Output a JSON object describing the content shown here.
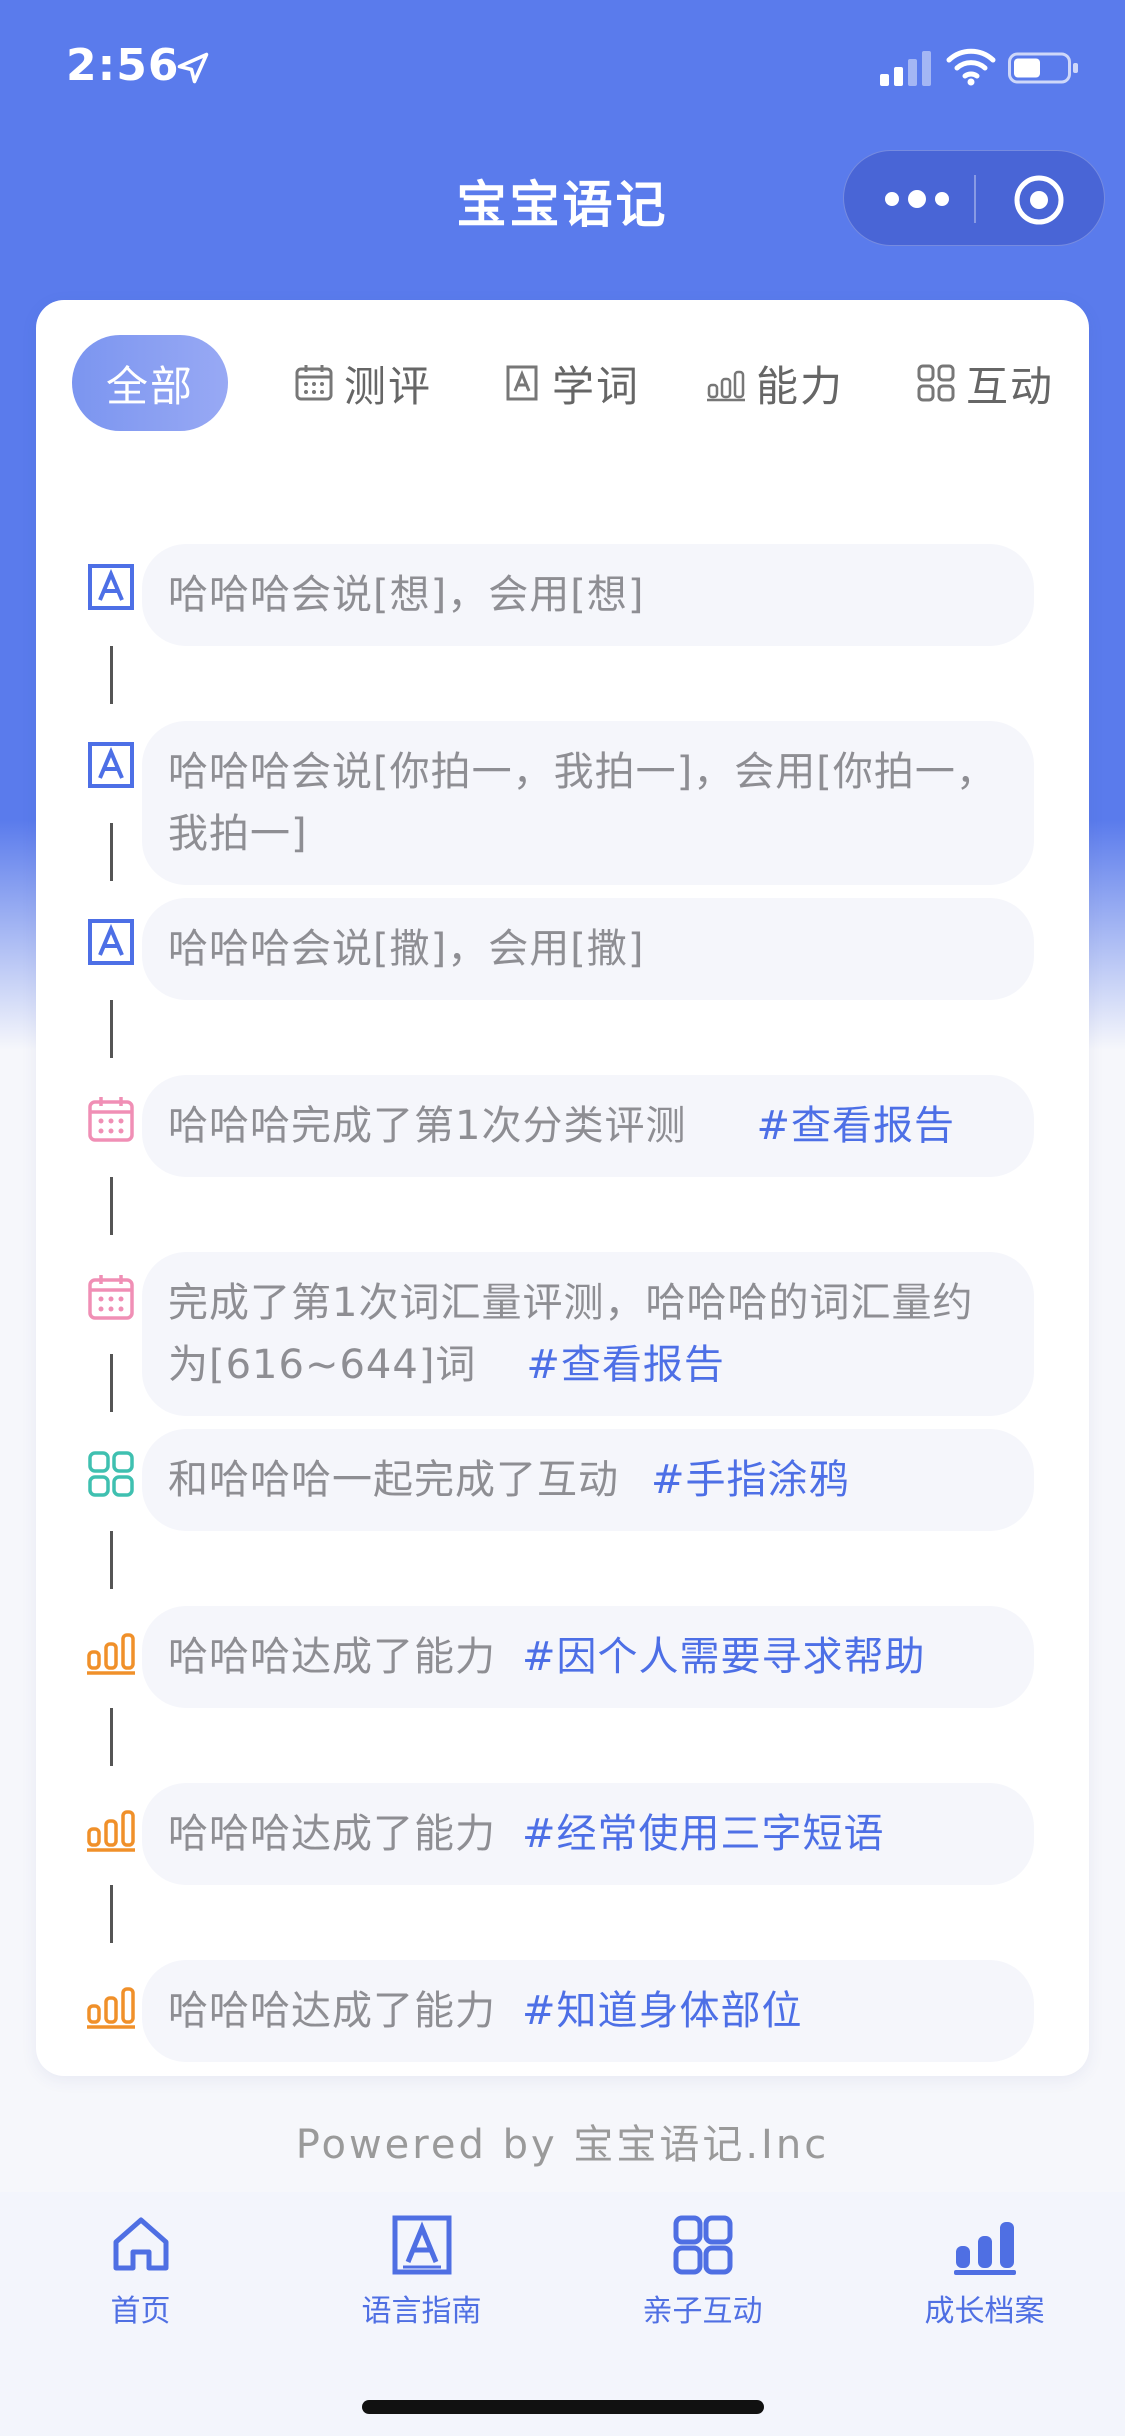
{
  "status_bar": {
    "time": "2:56"
  },
  "nav": {
    "title": "宝宝语记"
  },
  "tabs": [
    {
      "label": "全部",
      "icon": "none",
      "active": true
    },
    {
      "label": "测评",
      "icon": "calendar-icon"
    },
    {
      "label": "学词",
      "icon": "letter-a-icon"
    },
    {
      "label": "能力",
      "icon": "bar-chart-icon"
    },
    {
      "label": "互动",
      "icon": "grid-icon"
    }
  ],
  "timeline": [
    {
      "type": "learn",
      "icon": "letter-a-icon",
      "text": "哈哈哈会说[想]，会用[想]",
      "link": ""
    },
    {
      "type": "learn",
      "icon": "letter-a-icon",
      "text": "哈哈哈会说[你拍一，我拍一]，会用[你拍一，我拍一]",
      "link": ""
    },
    {
      "type": "learn",
      "icon": "letter-a-icon",
      "text": "哈哈哈会说[撒]，会用[撒]",
      "link": ""
    },
    {
      "type": "assess",
      "icon": "calendar-icon",
      "text": "哈哈哈完成了第1次分类评测",
      "link": "#查看报告"
    },
    {
      "type": "assess",
      "icon": "calendar-icon",
      "text": "完成了第1次词汇量评测，哈哈哈的词汇量约为[616~644]词",
      "link": "#查看报告"
    },
    {
      "type": "interact",
      "icon": "grid-icon",
      "text": "和哈哈哈一起完成了互动",
      "link": "#手指涂鸦"
    },
    {
      "type": "ability",
      "icon": "bar-chart-icon",
      "text": "哈哈哈达成了能力",
      "link": "#因个人需要寻求帮助"
    },
    {
      "type": "ability",
      "icon": "bar-chart-icon",
      "text": "哈哈哈达成了能力",
      "link": "#经常使用三字短语"
    },
    {
      "type": "ability",
      "icon": "bar-chart-icon",
      "text": "哈哈哈达成了能力",
      "link": "#知道身体部位"
    }
  ],
  "footer": {
    "powered": "Powered by 宝宝语记.Inc"
  },
  "tabbar": [
    {
      "label": "首页",
      "icon": "home-icon"
    },
    {
      "label": "语言指南",
      "icon": "letter-a-icon"
    },
    {
      "label": "亲子互动",
      "icon": "grid-icon"
    },
    {
      "label": "成长档案",
      "icon": "bar-chart-icon",
      "active": true
    }
  ],
  "colors": {
    "primary": "#5a7bec",
    "link": "#4d6fe6",
    "learn_icon": "#4d6fe6",
    "assess_icon": "#f08fb5",
    "interact_icon": "#3fc0b0",
    "ability_icon": "#f0902a"
  }
}
